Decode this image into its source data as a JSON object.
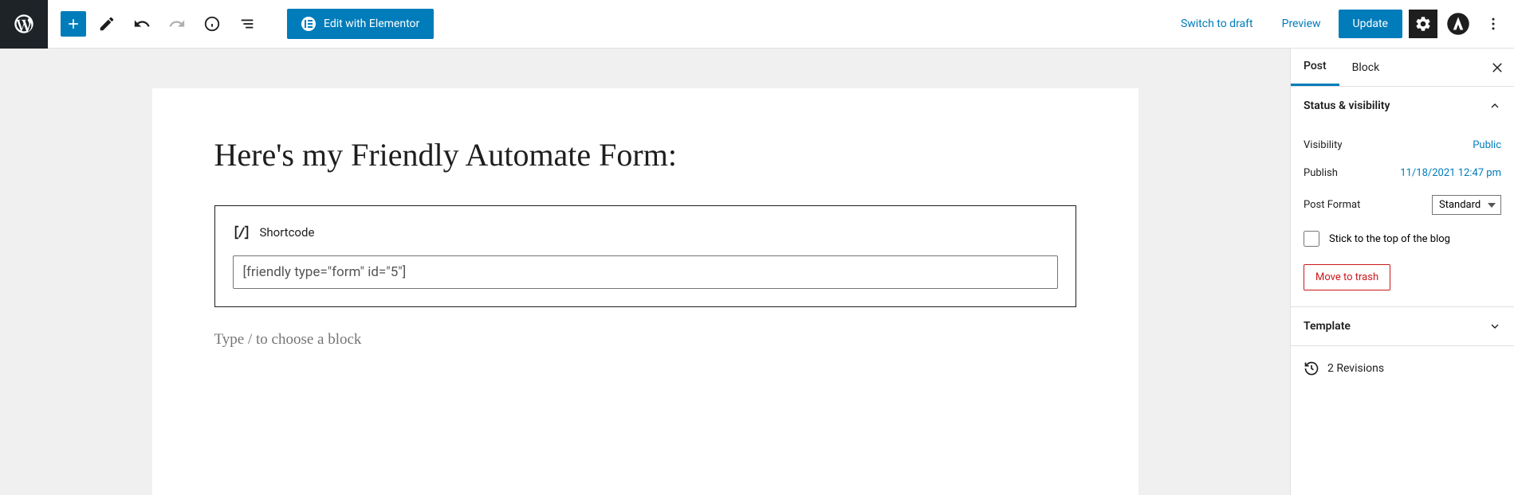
{
  "toolbar": {
    "elementor_label": "Edit with Elementor",
    "switch_draft": "Switch to draft",
    "preview": "Preview",
    "update": "Update"
  },
  "editor": {
    "title": "Here's my Friendly Automate Form:",
    "shortcode_label": "Shortcode",
    "shortcode_value": "[friendly type=\"form\" id=\"5\"]",
    "placeholder": "Type / to choose a block"
  },
  "sidebar": {
    "tabs": {
      "post": "Post",
      "block": "Block"
    },
    "panels": {
      "status": {
        "title": "Status & visibility",
        "visibility_label": "Visibility",
        "visibility_value": "Public",
        "publish_label": "Publish",
        "publish_value": "11/18/2021 12:47 pm",
        "format_label": "Post Format",
        "format_value": "Standard",
        "stick_label": "Stick to the top of the blog",
        "trash": "Move to trash"
      },
      "template": {
        "title": "Template"
      },
      "revisions": {
        "label": "2 Revisions"
      }
    }
  }
}
